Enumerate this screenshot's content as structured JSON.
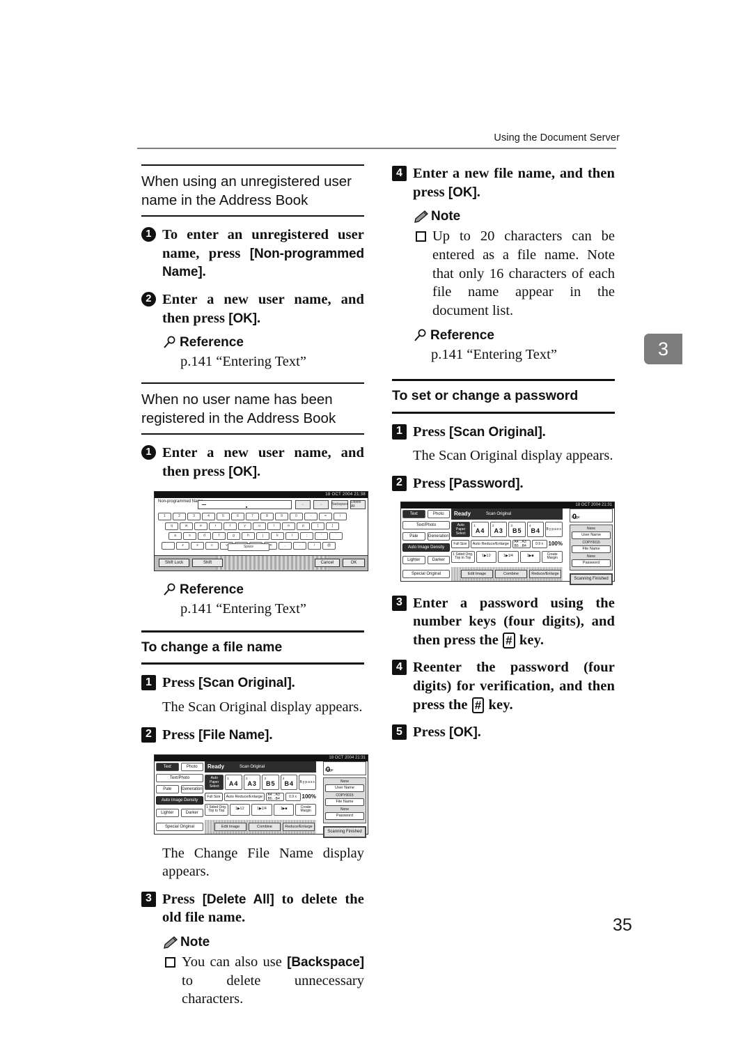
{
  "header": {
    "running_head": "Using the Document Server",
    "chapter_tab": "3",
    "folio": "35"
  },
  "left_column": {
    "section1": {
      "heading": "When using an unregistered user name in the Address Book",
      "steps": [
        {
          "num": "1",
          "style": "circle",
          "text_parts": [
            {
              "t": "To enter an unregistered user name, press ",
              "k": false
            },
            {
              "t": "[Non-programmed Name]",
              "k": true
            },
            {
              "t": ".",
              "k": false
            }
          ],
          "plain": "To enter an unregistered user name, press [Non-programmed Name]."
        },
        {
          "num": "2",
          "style": "circle",
          "text_parts": [
            {
              "t": "Enter a new user name, and then press ",
              "k": false
            },
            {
              "t": "[OK]",
              "k": true
            },
            {
              "t": ".",
              "k": false
            }
          ],
          "plain": "Enter a new user name, and then press [OK]."
        }
      ],
      "reference": {
        "title": "Reference",
        "body": "p.141 “Entering Text”"
      }
    },
    "section2": {
      "heading": "When no user name has been registered in the Address Book",
      "step1": {
        "num": "1",
        "plain": "Enter a new user name, and then press [OK]."
      },
      "reference": {
        "title": "Reference",
        "body": "p.141 “Entering Text”"
      }
    },
    "section3": {
      "heading": "To change a file name",
      "step1": {
        "num": "1",
        "plain": "Press [Scan Original]."
      },
      "step1_body": "The Scan Original display appears.",
      "step2": {
        "num": "2",
        "plain": "Press [File Name]."
      },
      "step2_body": "The Change File Name display appears.",
      "step3": {
        "num": "3",
        "plain": "Press [Delete All] to delete the old file name."
      },
      "note": {
        "title": "Note",
        "bullets": [
          "You can also use [Backspace] to delete unnecessary characters."
        ]
      }
    }
  },
  "right_column": {
    "step4": {
      "num": "4",
      "plain": "Enter a new file name, and then press [OK]."
    },
    "note": {
      "title": "Note",
      "bullets": [
        "Up to 20 characters can be entered as a file name. Note that only 16 characters of each file name appear in the document list."
      ]
    },
    "reference": {
      "title": "Reference",
      "body": "p.141 “Entering Text”"
    },
    "section_password": {
      "heading": "To set or change a password",
      "step1": {
        "num": "1",
        "plain": "Press [Scan Original]."
      },
      "step1_body": "The Scan Original display appears.",
      "step2": {
        "num": "2",
        "plain": "Press [Password]."
      },
      "step3": {
        "num": "3",
        "plain": "Enter a password using the number keys (four digits), and then press the [#] key."
      },
      "step4": {
        "num": "4",
        "plain": "Reenter the password (four digits) for verification, and then press the [#] key."
      },
      "step5": {
        "num": "5",
        "plain": "Press [OK]."
      }
    }
  },
  "figures": {
    "keyboard_panel": {
      "timestamp": "18 OCT 2004 21:38",
      "field_label": "Non-programmed Name",
      "buttons": {
        "left_arrow": "←",
        "right_arrow": "→",
        "backspace": "Backspace",
        "delete_all": "Delete All",
        "space": "Space",
        "shift_lock": "Shift Lock",
        "shift": "Shift",
        "cancel": "Cancel",
        "ok": "OK"
      },
      "rows": [
        [
          "1",
          "2",
          "3",
          "4",
          "5",
          "6",
          "7",
          "8",
          "9",
          "0",
          "-",
          "=",
          "\\"
        ],
        [
          "q",
          "w",
          "e",
          "r",
          "t",
          "y",
          "u",
          "i",
          "o",
          "p",
          "[",
          "]"
        ],
        [
          "a",
          "s",
          "d",
          "f",
          "g",
          "h",
          "j",
          "k",
          "l",
          ";",
          "'",
          "`"
        ],
        [
          "`",
          "z",
          "x",
          "c",
          "v",
          "b",
          "n",
          "m",
          ",",
          ".",
          "/",
          "@"
        ]
      ]
    },
    "scan_original_panel": {
      "timestamp": "18 OCT 2004 21:31",
      "status": "Ready",
      "mode_title": "Scan Original",
      "left_buttons": {
        "text": "Text",
        "photo": "Photo",
        "text_photo": "Text/Photo",
        "pale": "Pale",
        "generation": "Generation",
        "auto_image_density": "Auto Image Density",
        "lighter": "Lighter",
        "darker": "Darker",
        "special_original": "Special Original"
      },
      "paper_select_label": "Auto Paper Select",
      "paper_trays": [
        {
          "n": "1",
          "size": "A4"
        },
        {
          "n": "2",
          "size": "A3"
        },
        {
          "n": "3",
          "size": "B5"
        },
        {
          "n": "4",
          "size": "B4"
        }
      ],
      "bypass_label": "Bypass",
      "zoom_row": {
        "full_size": "Full Size",
        "auto_reduce_enlarge": "Auto Reduce/Enlarge",
        "ratio_preset": "A4→A3 B5→B4",
        "ratio_small": "0.9 x",
        "zoom_value": "100%"
      },
      "duplex_row": {
        "orig_label": "1 Sided Orig. Top to Top",
        "create_margin": "Create Margin"
      },
      "tab_buttons": [
        "Edit Image",
        "Combine",
        "Reduce/Enlarge"
      ],
      "right_panel": {
        "page_label": "Page",
        "page_value": "0",
        "user_name_value": "None",
        "user_name_button": "User Name",
        "file_name_value": "COPY0015",
        "file_name_button": "File Name",
        "password_value": "None",
        "password_button": "Password",
        "scanning_finished": "Scanning Finished"
      }
    }
  }
}
